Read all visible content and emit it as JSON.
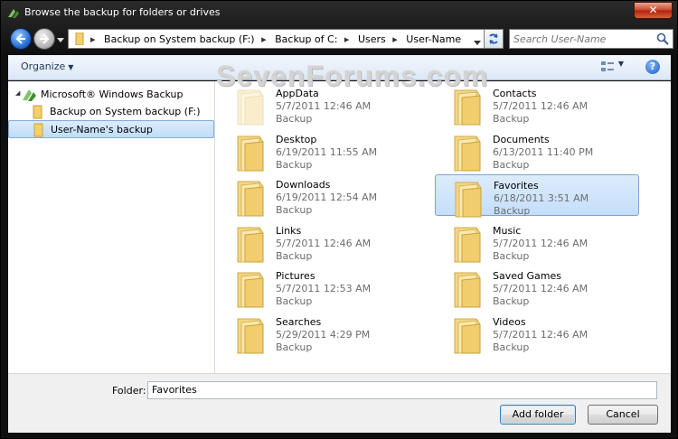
{
  "window": {
    "title": "Browse the backup for folders or drives",
    "close_glyph": "✕"
  },
  "address_bar": {
    "crumbs": [
      "Backup on System backup (F:)",
      "Backup of C:",
      "Users",
      "User-Name"
    ],
    "separator": "▸"
  },
  "search": {
    "placeholder": "Search User-Name"
  },
  "command_bar": {
    "organize_label": "Organize",
    "help_glyph": "?"
  },
  "watermark": "SevenForums.com",
  "navigation": {
    "items": [
      {
        "label": "Microsoft® Windows Backup",
        "icon": "windows-backup-icon"
      },
      {
        "label": "Backup on System backup (F:)",
        "icon": "folder-icon"
      },
      {
        "label": "User-Name's backup",
        "icon": "folder-icon",
        "selected": true
      }
    ]
  },
  "files": [
    {
      "name": "AppData",
      "date": "5/7/2011 12:46 AM",
      "type": "Backup",
      "faded": true
    },
    {
      "name": "Contacts",
      "date": "5/7/2011 12:46 AM",
      "type": "Backup"
    },
    {
      "name": "Desktop",
      "date": "6/19/2011 11:55 AM",
      "type": "Backup"
    },
    {
      "name": "Documents",
      "date": "6/13/2011 11:40 PM",
      "type": "Backup"
    },
    {
      "name": "Downloads",
      "date": "6/19/2011 12:54 AM",
      "type": "Backup"
    },
    {
      "name": "Favorites",
      "date": "6/18/2011 3:51 AM",
      "type": "Backup",
      "selected": true
    },
    {
      "name": "Links",
      "date": "5/7/2011 12:46 AM",
      "type": "Backup"
    },
    {
      "name": "Music",
      "date": "5/7/2011 12:46 AM",
      "type": "Backup"
    },
    {
      "name": "Pictures",
      "date": "5/7/2011 12:53 AM",
      "type": "Backup"
    },
    {
      "name": "Saved Games",
      "date": "5/7/2011 12:46 AM",
      "type": "Backup"
    },
    {
      "name": "Searches",
      "date": "5/29/2011 4:29 PM",
      "type": "Backup"
    },
    {
      "name": "Videos",
      "date": "5/7/2011 12:46 AM",
      "type": "Backup"
    }
  ],
  "footer": {
    "folder_label": "Folder:",
    "folder_value": "Favorites",
    "add_button": "Add folder",
    "cancel_button": "Cancel"
  },
  "colors": {
    "selection_bg": "#cce4fb",
    "folder_yellow": "#f6d77a"
  }
}
